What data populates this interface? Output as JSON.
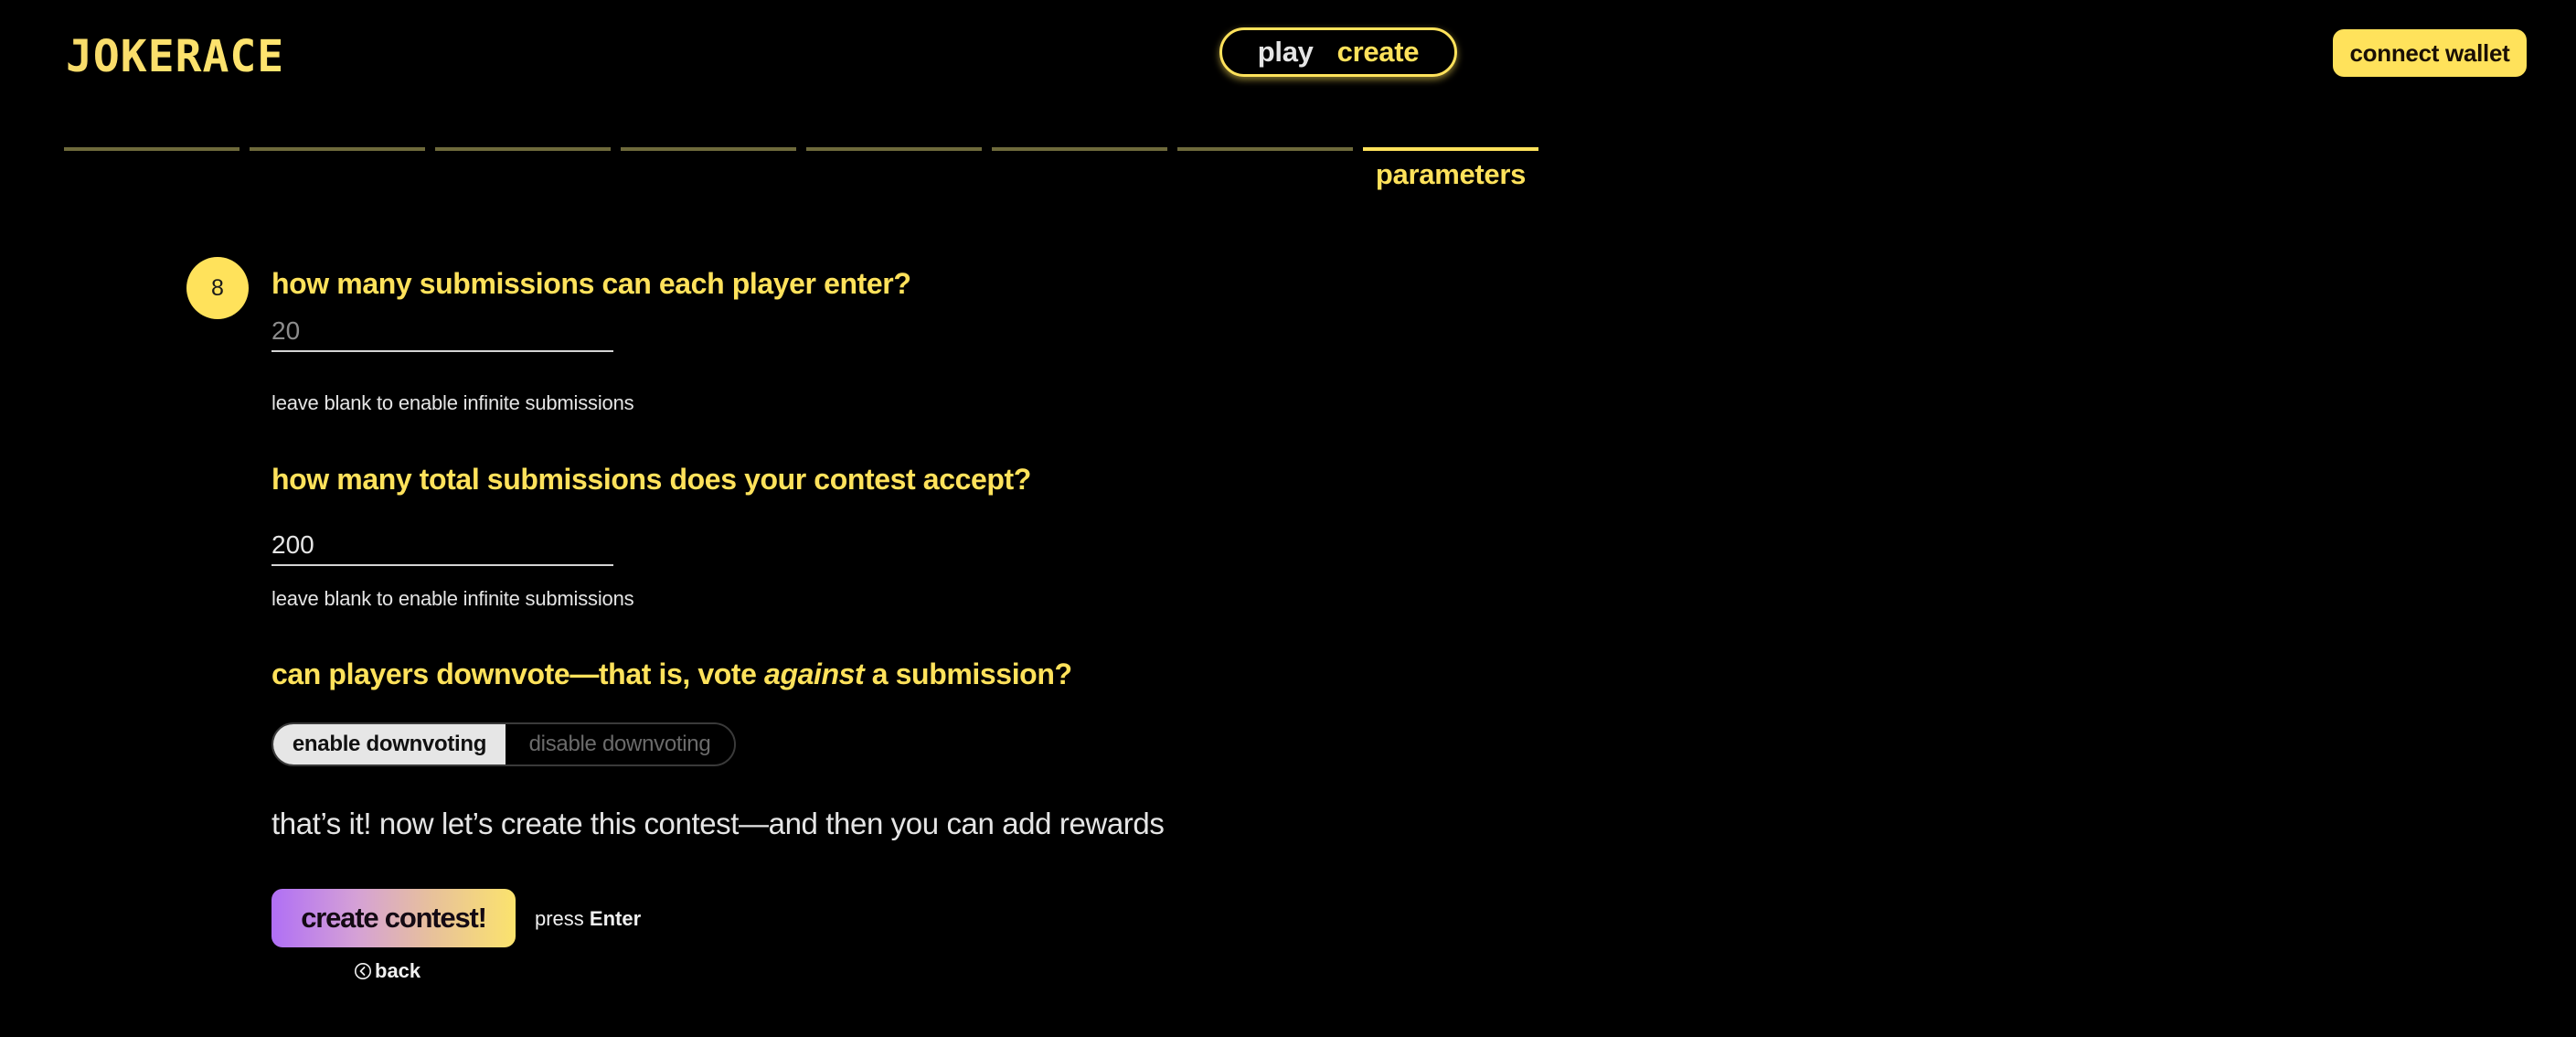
{
  "header": {
    "logo_text": "JOKERACE",
    "nav": {
      "play_label": "play",
      "create_label": "create"
    },
    "connect_wallet_label": "connect wallet"
  },
  "progress": {
    "total_steps": 8,
    "current_step": 8,
    "active_label": "parameters"
  },
  "form": {
    "step_number": "8",
    "per_player": {
      "question": "how many submissions can each player enter?",
      "value": "",
      "placeholder": "20",
      "helper": "leave blank to enable infinite submissions"
    },
    "total": {
      "question": "how many total submissions does your contest accept?",
      "value": "200",
      "placeholder": "",
      "helper": "leave blank to enable infinite submissions"
    },
    "downvote": {
      "question_before": "can players downvote—that is, vote ",
      "question_emphasis": "against",
      "question_after": " a submission?",
      "options": [
        {
          "label": "enable downvoting",
          "selected": true
        },
        {
          "label": "disable downvoting",
          "selected": false
        }
      ]
    },
    "closing_text": "that’s it! now let’s create this contest—and then you can add rewards",
    "create_button_label": "create contest!",
    "press_hint_prefix": "press ",
    "press_hint_key": "Enter",
    "back_label": "back"
  },
  "colors": {
    "background": "#000000",
    "accent_yellow": "#ffe25b",
    "inactive_step": "#6e6a3b",
    "gradient_start": "#b06ff5",
    "gradient_end": "#fbe36d"
  }
}
